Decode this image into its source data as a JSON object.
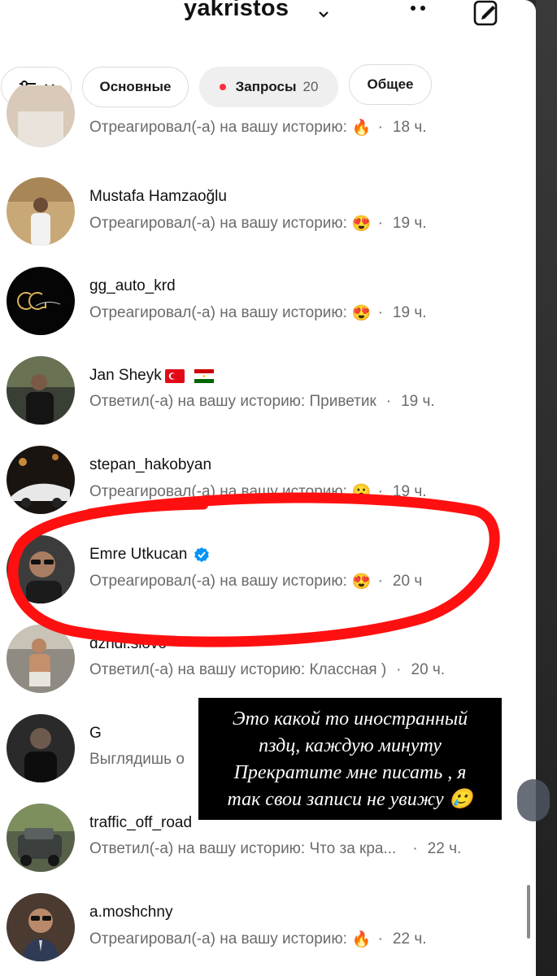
{
  "header": {
    "username": "yakristos"
  },
  "filters": {
    "primary_label": "Основные",
    "requests_label": "Запросы",
    "requests_count": "20",
    "general_label": "Общее"
  },
  "threads": [
    {
      "name": "",
      "message": "Отреагировал(-а) на вашу историю:",
      "emoji": "🔥",
      "time": "18 ч."
    },
    {
      "name": "Mustafa Hamzaoğlu",
      "message": "Отреагировал(-а) на вашу историю:",
      "emoji": "😍",
      "time": "19 ч."
    },
    {
      "name": "gg_auto_krd",
      "message": "Отреагировал(-а) на вашу историю:",
      "emoji": "😍",
      "time": "19 ч."
    },
    {
      "name": "Jan Sheyk",
      "message": "Ответил(-а) на вашу историю: Приветик",
      "emoji": "",
      "time": "19 ч."
    },
    {
      "name": "stepan_hakobyan",
      "message": "Отреагировал(-а) на вашу историю:",
      "emoji": "😮",
      "time": "19 ч."
    },
    {
      "name": "Emre Utkucan",
      "message": "Отреагировал(-а) на вашу историю:",
      "emoji": "😍",
      "time": "20 ч"
    },
    {
      "name": "dzhdi.slovo",
      "message": "Ответил(-а) на вашу историю: Классная )",
      "emoji": "",
      "time": "20 ч."
    },
    {
      "name": "G",
      "message": "Выглядишь о",
      "emoji": "",
      "time": ""
    },
    {
      "name": "traffic_off_road",
      "message": "Ответил(-а) на вашу историю: Что за кра...",
      "emoji": "",
      "time": "22 ч."
    },
    {
      "name": "a.moshchny",
      "message": "Отреагировал(-а) на вашу историю:",
      "emoji": "🔥",
      "time": "22 ч."
    }
  ],
  "overlay": {
    "line1": "Это какой то иностранный",
    "line2": "пздц, каждую минуту",
    "line3": "Прекратите мне писать , я",
    "line4": "так свои записи не увижу 🥲"
  },
  "colors": {
    "verified": "#0095f6",
    "annotation_red": "#ff1010",
    "unread_dot": "#ff2d3d"
  }
}
